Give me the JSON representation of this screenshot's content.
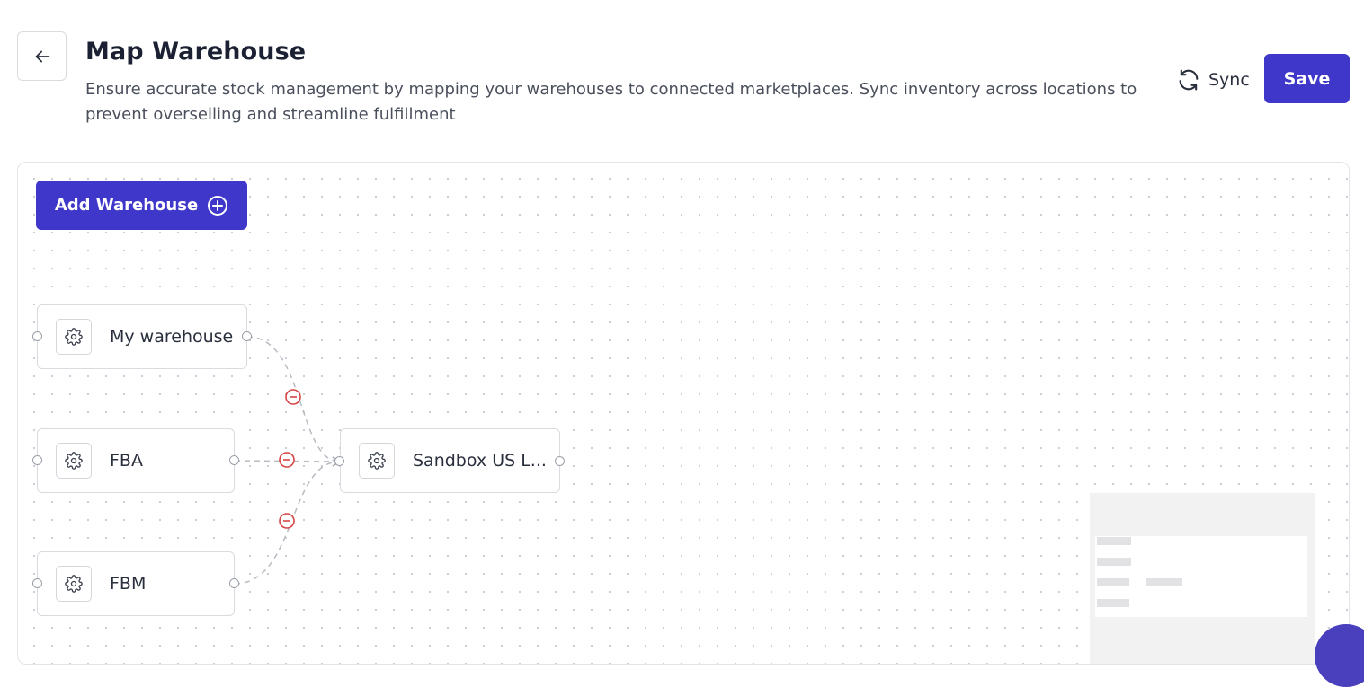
{
  "header": {
    "back_icon": "arrow-left-icon",
    "title": "Map Warehouse",
    "subtitle": "Ensure accurate stock management by mapping your warehouses to connected marketplaces. Sync inventory across locations to prevent overselling and streamline fulfillment",
    "sync_label": "Sync",
    "sync_icon": "refresh-icon",
    "save_label": "Save"
  },
  "canvas": {
    "add_warehouse_label": "Add Warehouse",
    "add_icon": "plus-circle-icon",
    "warehouses": [
      {
        "label": "My warehouse",
        "icon": "gear-icon"
      },
      {
        "label": "FBA",
        "icon": "gear-icon"
      },
      {
        "label": "FBM",
        "icon": "gear-icon"
      }
    ],
    "marketplace": {
      "label": "Sandbox US L...",
      "icon": "gear-icon"
    },
    "edge_remove_icon": "minus-circle-icon"
  },
  "colors": {
    "primary": "#3f37c9",
    "remove": "#d64545",
    "edge": "#b8bbc2"
  }
}
